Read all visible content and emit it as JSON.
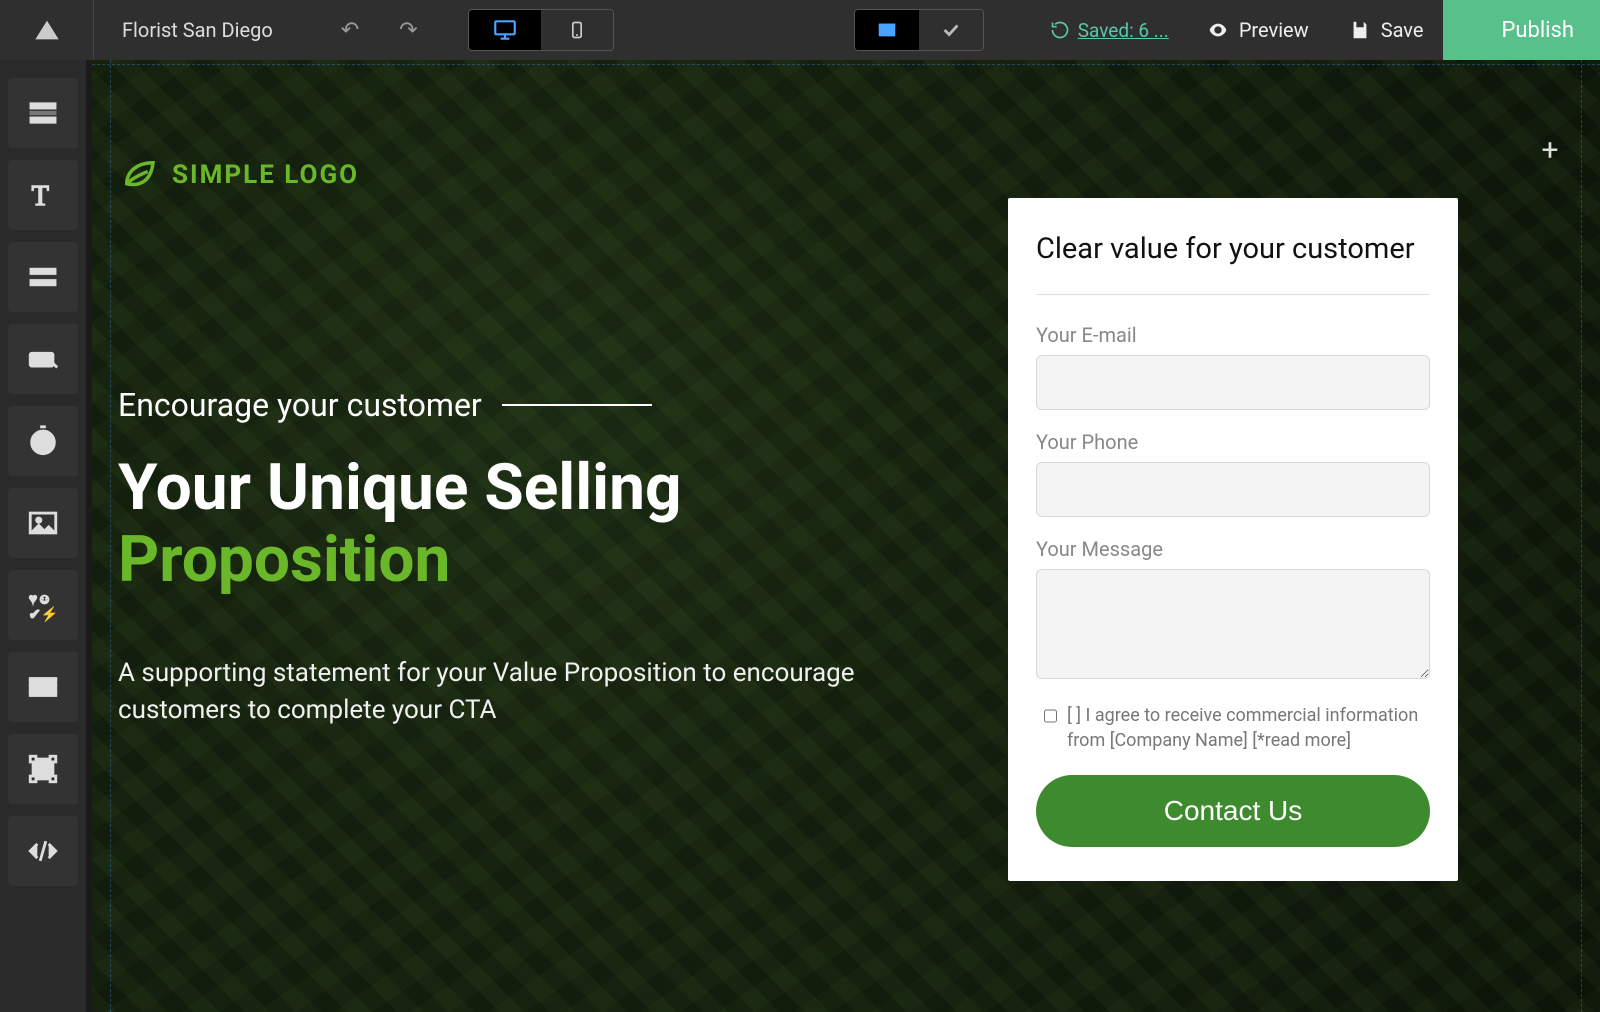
{
  "topbar": {
    "project_title": "Florist San Diego",
    "saved_label": " Saved: 6 ...",
    "preview_label": "Preview",
    "save_label": "Save",
    "publish_label": "Publish"
  },
  "logo": {
    "text": "SIMPLE LOGO"
  },
  "hero": {
    "tagline": "Encourage your customer",
    "headline_line1": "Your Unique Selling",
    "headline_line2": "Proposition",
    "subcopy": "A supporting statement for your Value Proposition to encourage customers to complete your CTA"
  },
  "form": {
    "heading": "Clear value for your customer",
    "email_label": "Your E-mail",
    "phone_label": "Your Phone",
    "message_label": "Your Message",
    "consent_text": "[ ] I agree to receive commercial information from [Company Name] [*read more]",
    "submit_label": "Contact Us"
  },
  "colors": {
    "accent_green": "#6ab82a",
    "button_green": "#3d8b2e",
    "publish_green": "#58c08a"
  }
}
